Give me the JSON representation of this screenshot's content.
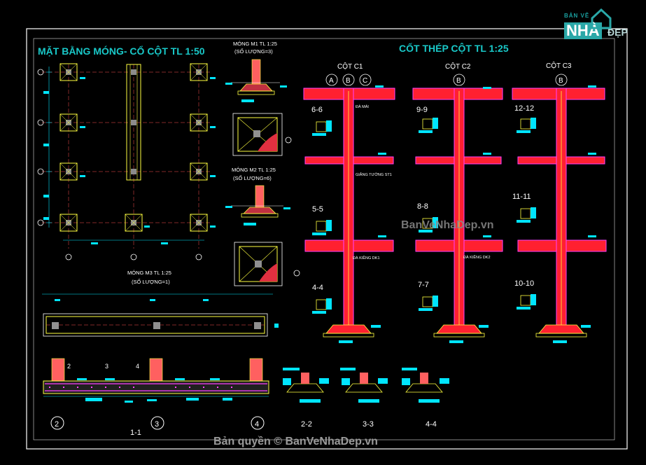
{
  "titles": {
    "plan": "MẶT BẰNG MÓNG- CỔ CỘT TL 1:50",
    "rebar": "CỐT THÉP CỘT TL 1:25"
  },
  "footings": [
    {
      "name": "MÓNG M1  TL 1:25",
      "qty": "(SỐ LƯỢNG=3)"
    },
    {
      "name": "MÓNG M2  TL 1:25",
      "qty": "(SỐ LƯỢNG=6)"
    },
    {
      "name": "MÓNG M3 TL 1:25",
      "qty": "(SỐ LƯỢNG=1)"
    }
  ],
  "columns": [
    {
      "name": "CỘT C1",
      "axes": [
        "A",
        "B",
        "C"
      ]
    },
    {
      "name": "CỘT C2",
      "axes": [
        "B"
      ]
    },
    {
      "name": "CỘT C3",
      "axes": [
        "B"
      ]
    }
  ],
  "sections_c1": [
    "6-6",
    "5-5",
    "4-4"
  ],
  "sections_c2": [
    "9-9",
    "8-8",
    "7-7"
  ],
  "sections_c3": [
    "12-12",
    "11-11",
    "10-10"
  ],
  "beam_labels": [
    "ĐÀ MÁI",
    "GIẰNG TƯỜNG ST1",
    "ĐÀ KIỀNG DK1",
    "ĐÀ KIỀNG DK2"
  ],
  "beam_section_nums": [
    "2",
    "3",
    "4"
  ],
  "beam_axes": [
    "2",
    "3",
    "4"
  ],
  "beam_section_title": "1-1",
  "small_sections": [
    "2-2",
    "3-3",
    "4-4"
  ],
  "watermark": "BanVeNhaDep.vn",
  "copyright": "Bản quyền © BanVeNhaDep.vn",
  "logo": {
    "top": "BẢN VẼ",
    "main": "NHÀ",
    "sub": "ĐẸP"
  },
  "colors": {
    "background": "#000000",
    "title": "#19c8c8",
    "red": "#ff2030",
    "magenta": "#ff40ff",
    "yellow": "#ffff40",
    "white": "#ffffff",
    "cyan": "#00e5ff"
  }
}
